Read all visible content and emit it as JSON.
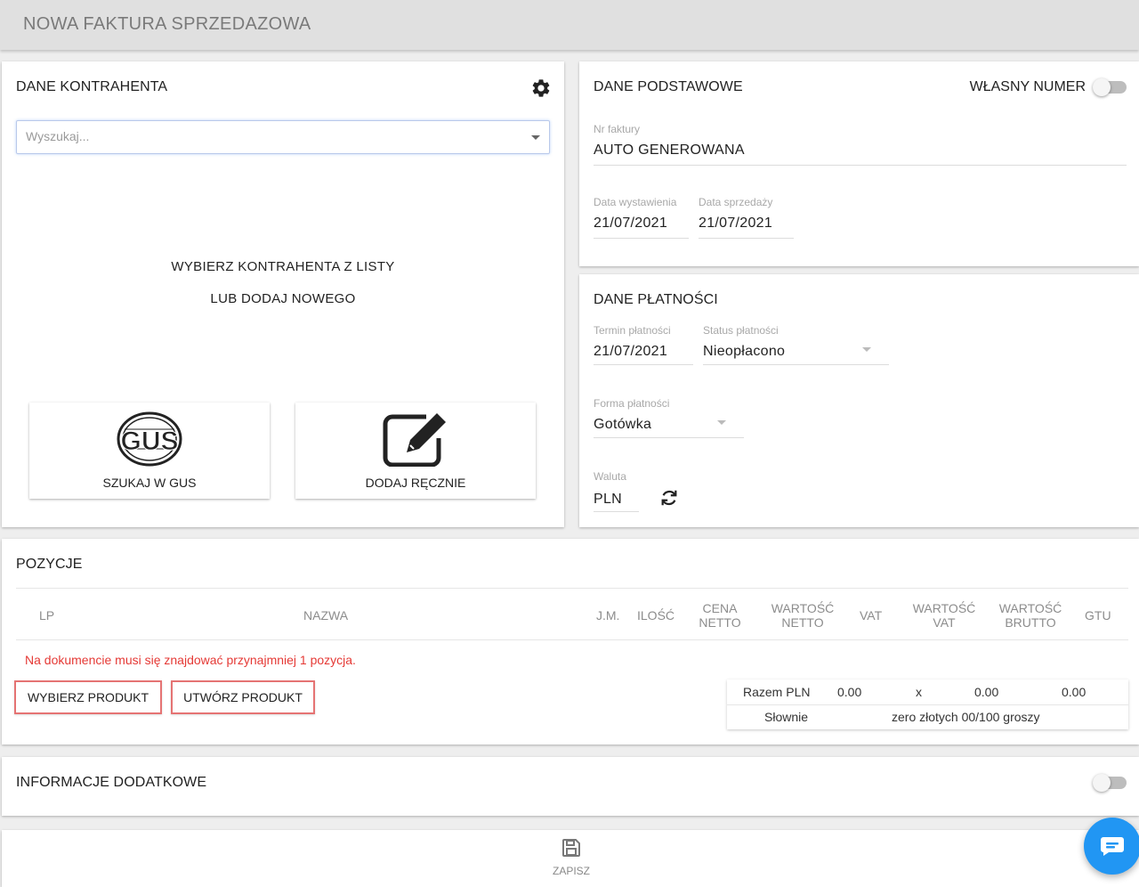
{
  "page": {
    "title": "NOWA FAKTURA SPRZEDAZOWA"
  },
  "contractor": {
    "title": "DANE KONTRAHENTA",
    "search_placeholder": "Wyszukaj...",
    "prompt_line1": "WYBIERZ KONTRAHENTA Z LISTY",
    "prompt_line2": "LUB DODAJ NOWEGO",
    "gus_label": "SZUKAJ W GUS",
    "gus_logo_text": "GUS",
    "manual_label": "DODAJ RĘCZNIE"
  },
  "basic": {
    "title": "DANE PODSTAWOWE",
    "own_number_label": "WŁASNY NUMER",
    "invoice_no_label": "Nr faktury",
    "invoice_no_value": "AUTO GENEROWANA",
    "issue_date_label": "Data wystawienia",
    "issue_date_value": "21/07/2021",
    "sale_date_label": "Data sprzedaży",
    "sale_date_value": "21/07/2021"
  },
  "payment": {
    "title": "DANE PŁATNOŚCI",
    "due_label": "Termin płatności",
    "due_value": "21/07/2021",
    "status_label": "Status płatności",
    "status_value": "Nieopłacono",
    "method_label": "Forma płatności",
    "method_value": "Gotówka",
    "currency_label": "Waluta",
    "currency_value": "PLN"
  },
  "positions": {
    "title": "POZYCJE",
    "columns": {
      "lp": "LP",
      "name": "NAZWA",
      "unit": "J.M.",
      "qty": "ILOŚĆ",
      "net_price_1": "CENA",
      "net_price_2": "NETTO",
      "net_value_1": "WARTOŚĆ",
      "net_value_2": "NETTO",
      "vat": "VAT",
      "vat_value_1": "WARTOŚĆ",
      "vat_value_2": "VAT",
      "gross_value_1": "WARTOŚĆ",
      "gross_value_2": "BRUTTO",
      "gtu": "GTU"
    },
    "error": "Na dokumencie musi się znajdować przynajmniej 1 pozycja.",
    "select_product": "WYBIERZ PRODUKT",
    "create_product": "UTWÓRZ PRODUKT",
    "summary": {
      "total_label": "Razem PLN",
      "net": "0.00",
      "vat": "x",
      "vat_value": "0.00",
      "gross": "0.00",
      "words_label": "Słownie",
      "words_value": "zero złotych 00/100 groszy"
    }
  },
  "info": {
    "title": "INFORMACJE DODATKOWE"
  },
  "save": {
    "label": "ZAPISZ"
  },
  "colors": {
    "accent_blue": "#2196f3",
    "error_red": "#e53935",
    "button_border": "#e57373"
  }
}
